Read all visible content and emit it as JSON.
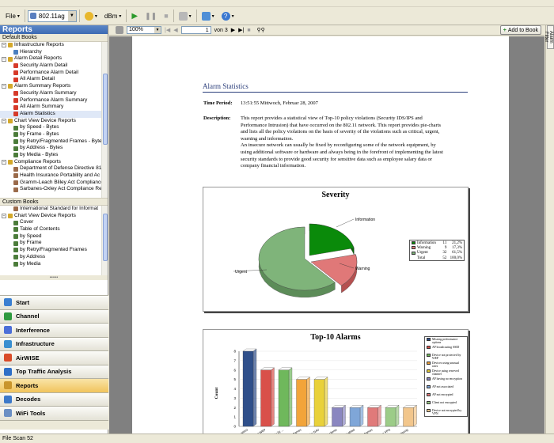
{
  "app": {
    "menu_file": "File",
    "adapter": "802.11ag",
    "dbm": "dBm",
    "status_text": "File Scan 52"
  },
  "left": {
    "header": "Reports",
    "default_books_label": "Default Books",
    "custom_books_label": "Custom Books",
    "default_tree": [
      {
        "label": "Infrastructure Reports",
        "level": 0,
        "pm": "−",
        "icon": "book"
      },
      {
        "label": "Hierarchy",
        "level": 1,
        "icon": "tree"
      },
      {
        "label": "Alarm Detail Reports",
        "level": 0,
        "pm": "−",
        "icon": "book"
      },
      {
        "label": "Security Alarm Detail",
        "level": 1,
        "icon": "alarm"
      },
      {
        "label": "Performance Alarm Detail",
        "level": 1,
        "icon": "alarm"
      },
      {
        "label": "All Alarm Detail",
        "level": 1,
        "icon": "alarm"
      },
      {
        "label": "Alarm Summary Reports",
        "level": 0,
        "pm": "−",
        "icon": "book"
      },
      {
        "label": "Security Alarm Summary",
        "level": 1,
        "icon": "alarm"
      },
      {
        "label": "Performance Alarm Summary",
        "level": 1,
        "icon": "alarm"
      },
      {
        "label": "All Alarm Summary",
        "level": 1,
        "icon": "alarm"
      },
      {
        "label": "Alarm Statistics",
        "level": 1,
        "icon": "alarm",
        "selected": true
      },
      {
        "label": "Chart View Device Reports",
        "level": 0,
        "pm": "−",
        "icon": "book"
      },
      {
        "label": "by Speed - Bytes",
        "level": 1,
        "icon": "chart"
      },
      {
        "label": "by Frame - Bytes",
        "level": 1,
        "icon": "chart"
      },
      {
        "label": "by Retry/Fragmented Frames - Byte",
        "level": 1,
        "icon": "chart"
      },
      {
        "label": "by Address - Bytes",
        "level": 1,
        "icon": "chart"
      },
      {
        "label": "by Media - Bytes",
        "level": 1,
        "icon": "chart"
      },
      {
        "label": "Compliance Reports",
        "level": 0,
        "pm": "−",
        "icon": "book"
      },
      {
        "label": "Department of Defense Directive 81",
        "level": 1,
        "icon": "doc"
      },
      {
        "label": "Health Insurance Portability and Ac",
        "level": 1,
        "icon": "doc"
      },
      {
        "label": "Gramm-Leach Bliley Act Compliance",
        "level": 1,
        "icon": "doc"
      },
      {
        "label": "Sarbanes-Oxley Act Compliance Re",
        "level": 1,
        "icon": "doc"
      }
    ],
    "custom_tree": [
      {
        "label": "International Standard for Informat",
        "level": 1,
        "icon": "doc"
      },
      {
        "label": "Chart View Device Reports",
        "level": 0,
        "pm": "−",
        "icon": "book"
      },
      {
        "label": "Cover",
        "level": 1,
        "icon": "chart"
      },
      {
        "label": "Table of Contents",
        "level": 1,
        "icon": "chart"
      },
      {
        "label": "by Speed",
        "level": 1,
        "icon": "chart"
      },
      {
        "label": "by Frame",
        "level": 1,
        "icon": "chart"
      },
      {
        "label": "by Retry/Fragmented Frames",
        "level": 1,
        "icon": "chart"
      },
      {
        "label": "by Address",
        "level": 1,
        "icon": "chart"
      },
      {
        "label": "by Media",
        "level": 1,
        "icon": "chart"
      }
    ],
    "nav": [
      {
        "label": "Start",
        "color": "#3b7fd1"
      },
      {
        "label": "Channel",
        "color": "#2f9a3f"
      },
      {
        "label": "Interference",
        "color": "#4c6fd8"
      },
      {
        "label": "Infrastructure",
        "color": "#3a8fd0"
      },
      {
        "label": "AirWISE",
        "color": "#d94c2a"
      },
      {
        "label": "Top Traffic Analysis",
        "color": "#2f6fc7"
      },
      {
        "label": "Reports",
        "color": "#c9952c",
        "active": true
      },
      {
        "label": "Decodes",
        "color": "#3d79c9"
      },
      {
        "label": "WiFi Tools",
        "color": "#6b8fc4"
      }
    ]
  },
  "viewer": {
    "zoom": "100%",
    "page_current": "1",
    "page_of": "von 3",
    "add_to_book": "Add to Book",
    "right_tab": "Alarm Filter"
  },
  "report": {
    "title": "Alarm Statistics",
    "time_label": "Time Period:",
    "time_value": "13:51:55  Mittwoch, Februar 28, 2007",
    "desc_label": "Description:",
    "desc_lines": [
      "This report provides a statistical view of Top-10 policy violations (Security IDS/IPS and",
      "Performance Intrusion) that have occurred on the 802.11 network. This report provides pie-charts",
      "and lists all the policy violations on the basis of severity of the violations such as critical, urgent,",
      "warning and information.",
      "An insecure network can usually be fixed by reconfiguring some of the network equipment, by",
      "using additional software or hardware and always being in the forefront of implementing the latest",
      "security standards to provide good security for sensitive data such as employee salary data or",
      "company financial information."
    ]
  },
  "colors": {
    "information": "#0a8a0a",
    "warning": "#e07878",
    "urgent": "#7fb47a"
  },
  "chart_data": [
    {
      "type": "pie",
      "title": "Severity",
      "slices": [
        {
          "name": "Information",
          "count": 11,
          "percent": "21,2%",
          "value": 21.2
        },
        {
          "name": "Warning",
          "count": 9,
          "percent": "17,3%",
          "value": 17.3
        },
        {
          "name": "Urgent",
          "count": 32,
          "percent": "61,5%",
          "value": 61.5
        }
      ],
      "total_label": "Total",
      "total_count": 52,
      "total_percent": "100,0%",
      "slice_labels": [
        "Information",
        "Warning",
        "Urgent"
      ]
    },
    {
      "type": "bar",
      "title": "Top-10 Alarms",
      "ylabel": "Count",
      "ylim": [
        0,
        8
      ],
      "yticks": [
        "0",
        "1",
        "2",
        "3",
        "4",
        "5",
        "6",
        "7",
        "8"
      ],
      "categories": [
        "performance optimi",
        "encrypted using WEP",
        "Suspicious activity by ...",
        "Unprotected frames",
        "Detected by NAV",
        "Unauthorized clients",
        "AP protocol disabled",
        "AP suspicious frames",
        "Encrypted by VPN",
        "RSN IE missing"
      ],
      "values": [
        8,
        6,
        6,
        5,
        5,
        2,
        2,
        2,
        2,
        2
      ],
      "bar_colors": [
        "#2f4f8a",
        "#d9504a",
        "#6fb85c",
        "#f2a43a",
        "#e9d13a",
        "#8a86c0",
        "#7fa6d8",
        "#e07a7a",
        "#9ccc88",
        "#f2c68c"
      ],
      "legend": [
        "Missing performance options",
        "AP broadcasting SSID",
        "Device not protected by WEP",
        "Devices using unusual rates",
        "Device using reserved channel",
        "AP having no encryption",
        "AP not associated",
        "AP not encrypted",
        "Client not encrypted",
        "Device not encrypted by VPN"
      ]
    }
  ]
}
